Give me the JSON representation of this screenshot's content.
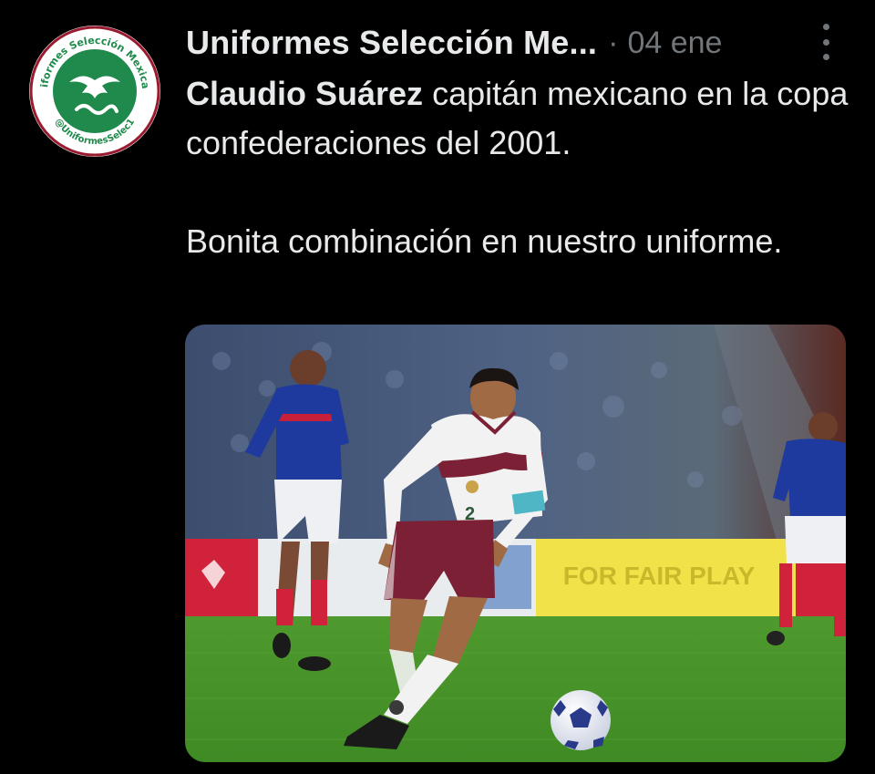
{
  "post": {
    "author_name": "Uniformes Selección Me...",
    "separator": "·",
    "date": "04 ene",
    "text": {
      "mention": "Claudio Suárez",
      "line1_rest": " capitán mexicano en la copa confederaciones del 2001.",
      "paragraph2": "Bonita combinación en nuestro uniforme."
    },
    "more_icon": "more-vertical-icon"
  },
  "avatar": {
    "ring_text_top": "Uniformes Selección Mexicana",
    "ring_text_bottom": "@UniformesSelec1",
    "colors": {
      "ring": "#ffffff",
      "green": "#1f8a4c",
      "text": "#1f8a4c",
      "border": "#9a1b2f"
    }
  },
  "photo": {
    "shirt_number": "2",
    "ad_board_text": "FOR FAIR PLAY"
  },
  "colors": {
    "background": "#000000",
    "text_primary": "#e7e9ea",
    "text_secondary": "#71767b"
  }
}
